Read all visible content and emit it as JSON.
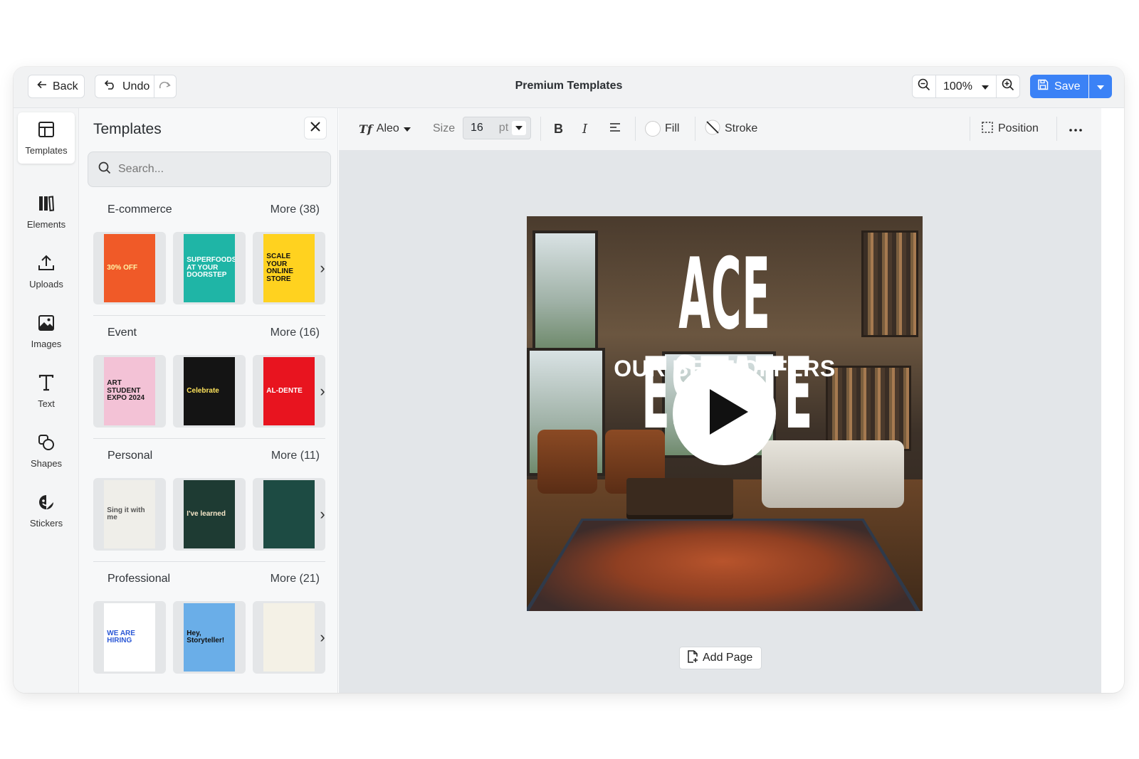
{
  "app": {
    "title": "Premium Templates",
    "back_label": "Back",
    "undo_label": "Undo",
    "zoom": "100%",
    "save_label": "Save",
    "accent_color": "#3b82f6"
  },
  "rail": {
    "items": [
      {
        "label": "Templates",
        "icon": "templates-icon"
      },
      {
        "label": "Elements",
        "icon": "elements-icon"
      },
      {
        "label": "Uploads",
        "icon": "upload-icon"
      },
      {
        "label": "Images",
        "icon": "image-icon"
      },
      {
        "label": "Text",
        "icon": "text-icon"
      },
      {
        "label": "Shapes",
        "icon": "shapes-icon"
      },
      {
        "label": "Stickers",
        "icon": "sticker-icon"
      }
    ]
  },
  "panel": {
    "title": "Templates",
    "search_placeholder": "Search...",
    "categories": [
      {
        "name": "E-commerce",
        "more": "More (38)",
        "thumbs": [
          {
            "text": "30% OFF",
            "bg": "#f05a28",
            "fg": "#fff3a6"
          },
          {
            "text": "SUPERFOODS AT YOUR DOORSTEP",
            "bg": "#1fb5a6",
            "fg": "#ffffff"
          },
          {
            "text": "SCALE YOUR ONLINE STORE",
            "bg": "#ffd21f",
            "fg": "#111111"
          }
        ]
      },
      {
        "name": "Event",
        "more": "More (16)",
        "thumbs": [
          {
            "text": "ART STUDENT EXPO 2024",
            "bg": "#f3c2d6",
            "fg": "#1b1b1b"
          },
          {
            "text": "Celebrate",
            "bg": "#141414",
            "fg": "#ffe45c"
          },
          {
            "text": "AL-DENTE",
            "bg": "#e8141f",
            "fg": "#ffffff"
          }
        ]
      },
      {
        "name": "Personal",
        "more": "More (11)",
        "thumbs": [
          {
            "text": "Sing it with me",
            "bg": "#efeee9",
            "fg": "#555555"
          },
          {
            "text": "I've learned",
            "bg": "#1e3b33",
            "fg": "#f6e7c9"
          },
          {
            "text": "",
            "bg": "#1d4b43",
            "fg": "#e6d2a2"
          }
        ]
      },
      {
        "name": "Professional",
        "more": "More (21)",
        "thumbs": [
          {
            "text": "WE ARE HIRING",
            "bg": "#ffffff",
            "fg": "#2a57d6"
          },
          {
            "text": "Hey, Storyteller!",
            "bg": "#6aaee8",
            "fg": "#111111"
          },
          {
            "text": "",
            "bg": "#f4f1e6",
            "fg": "#f4d21f"
          }
        ]
      }
    ]
  },
  "toolbar": {
    "font": "Aleo",
    "size_label": "Size",
    "size_value": "16",
    "size_unit": "pt",
    "bold": "B",
    "italic": "I",
    "fill_label": "Fill",
    "stroke_label": "Stroke",
    "position_label": "Position"
  },
  "canvas": {
    "headline": "ACE ESTATE",
    "subheadline": "OUR BEST OFFERS",
    "add_page_label": "Add Page"
  }
}
